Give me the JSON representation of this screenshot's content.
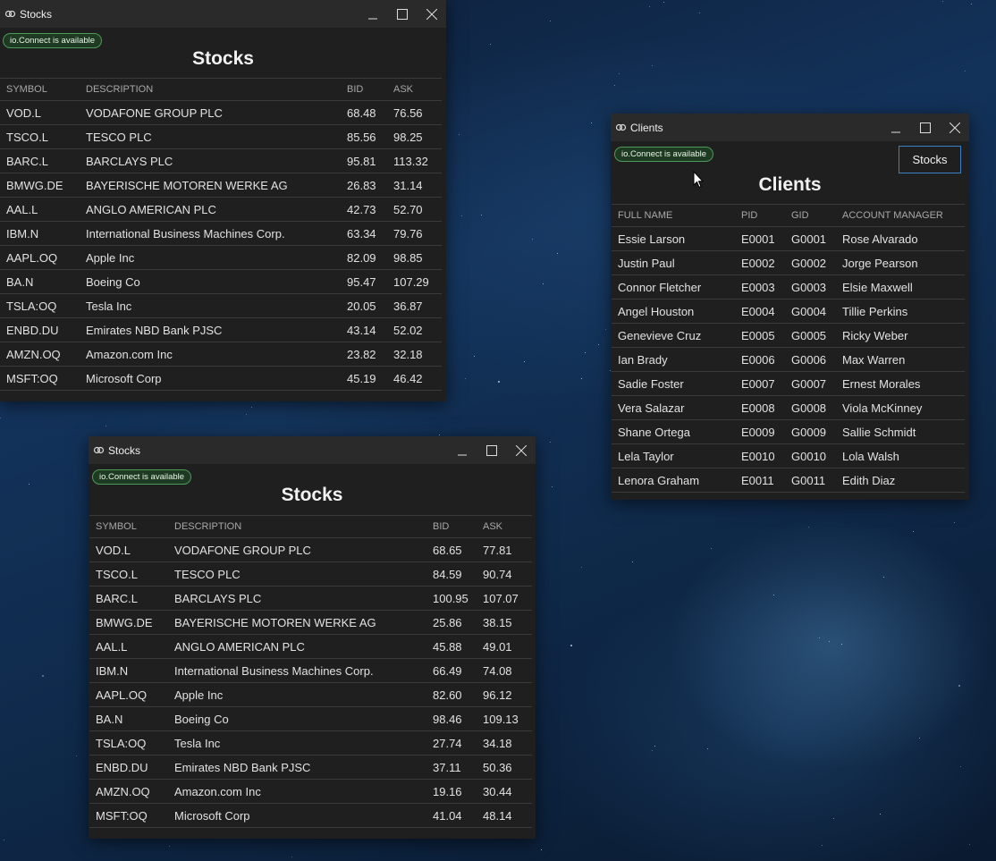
{
  "windows": {
    "stocks_top": {
      "title": "Stocks",
      "badge": "io.Connect is available",
      "heading": "Stocks",
      "columns": [
        "SYMBOL",
        "DESCRIPTION",
        "BID",
        "ASK"
      ],
      "rows": [
        [
          "VOD.L",
          "VODAFONE GROUP PLC",
          "68.48",
          "76.56"
        ],
        [
          "TSCO.L",
          "TESCO PLC",
          "85.56",
          "98.25"
        ],
        [
          "BARC.L",
          "BARCLAYS PLC",
          "95.81",
          "113.32"
        ],
        [
          "BMWG.DE",
          "BAYERISCHE MOTOREN WERKE AG",
          "26.83",
          "31.14"
        ],
        [
          "AAL.L",
          "ANGLO AMERICAN PLC",
          "42.73",
          "52.70"
        ],
        [
          "IBM.N",
          "International Business Machines Corp.",
          "63.34",
          "79.76"
        ],
        [
          "AAPL.OQ",
          "Apple Inc",
          "82.09",
          "98.85"
        ],
        [
          "BA.N",
          "Boeing Co",
          "95.47",
          "107.29"
        ],
        [
          "TSLA:OQ",
          "Tesla Inc",
          "20.05",
          "36.87"
        ],
        [
          "ENBD.DU",
          "Emirates NBD Bank PJSC",
          "43.14",
          "52.02"
        ],
        [
          "AMZN.OQ",
          "Amazon.com Inc",
          "23.82",
          "32.18"
        ],
        [
          "MSFT:OQ",
          "Microsoft Corp",
          "45.19",
          "46.42"
        ]
      ]
    },
    "stocks_bottom": {
      "title": "Stocks",
      "badge": "io.Connect is available",
      "heading": "Stocks",
      "columns": [
        "SYMBOL",
        "DESCRIPTION",
        "BID",
        "ASK"
      ],
      "rows": [
        [
          "VOD.L",
          "VODAFONE GROUP PLC",
          "68.65",
          "77.81"
        ],
        [
          "TSCO.L",
          "TESCO PLC",
          "84.59",
          "90.74"
        ],
        [
          "BARC.L",
          "BARCLAYS PLC",
          "100.95",
          "107.07"
        ],
        [
          "BMWG.DE",
          "BAYERISCHE MOTOREN WERKE AG",
          "25.86",
          "38.15"
        ],
        [
          "AAL.L",
          "ANGLO AMERICAN PLC",
          "45.88",
          "49.01"
        ],
        [
          "IBM.N",
          "International Business Machines Corp.",
          "66.49",
          "74.08"
        ],
        [
          "AAPL.OQ",
          "Apple Inc",
          "82.60",
          "96.12"
        ],
        [
          "BA.N",
          "Boeing Co",
          "98.46",
          "109.13"
        ],
        [
          "TSLA:OQ",
          "Tesla Inc",
          "27.74",
          "34.18"
        ],
        [
          "ENBD.DU",
          "Emirates NBD Bank PJSC",
          "37.11",
          "50.36"
        ],
        [
          "AMZN.OQ",
          "Amazon.com Inc",
          "19.16",
          "30.44"
        ],
        [
          "MSFT:OQ",
          "Microsoft Corp",
          "41.04",
          "48.14"
        ]
      ]
    },
    "clients": {
      "title": "Clients",
      "badge": "io.Connect is available",
      "heading": "Clients",
      "stocks_button": "Stocks",
      "columns": [
        "FULL NAME",
        "PID",
        "GID",
        "ACCOUNT MANAGER"
      ],
      "rows": [
        [
          "Essie Larson",
          "E0001",
          "G0001",
          "Rose Alvarado"
        ],
        [
          "Justin Paul",
          "E0002",
          "G0002",
          "Jorge Pearson"
        ],
        [
          "Connor Fletcher",
          "E0003",
          "G0003",
          "Elsie Maxwell"
        ],
        [
          "Angel Houston",
          "E0004",
          "G0004",
          "Tillie Perkins"
        ],
        [
          "Genevieve Cruz",
          "E0005",
          "G0005",
          "Ricky Weber"
        ],
        [
          "Ian Brady",
          "E0006",
          "G0006",
          "Max Warren"
        ],
        [
          "Sadie Foster",
          "E0007",
          "G0007",
          "Ernest Morales"
        ],
        [
          "Vera Salazar",
          "E0008",
          "G0008",
          "Viola McKinney"
        ],
        [
          "Shane Ortega",
          "E0009",
          "G0009",
          "Sallie Schmidt"
        ],
        [
          "Lela Taylor",
          "E0010",
          "G0010",
          "Lola Walsh"
        ],
        [
          "Lenora Graham",
          "E0011",
          "G0011",
          "Edith Diaz"
        ]
      ]
    }
  },
  "icons": {
    "app": "link-icon",
    "minimize": "minimize-icon",
    "maximize": "maximize-icon",
    "close": "close-icon",
    "cursor": "mouse-cursor-icon"
  },
  "colors": {
    "window_bg": "#1f1f1f",
    "titlebar_bg": "#2a2a2a",
    "badge_border": "#4d9a5a",
    "button_border": "#3b82c4"
  }
}
